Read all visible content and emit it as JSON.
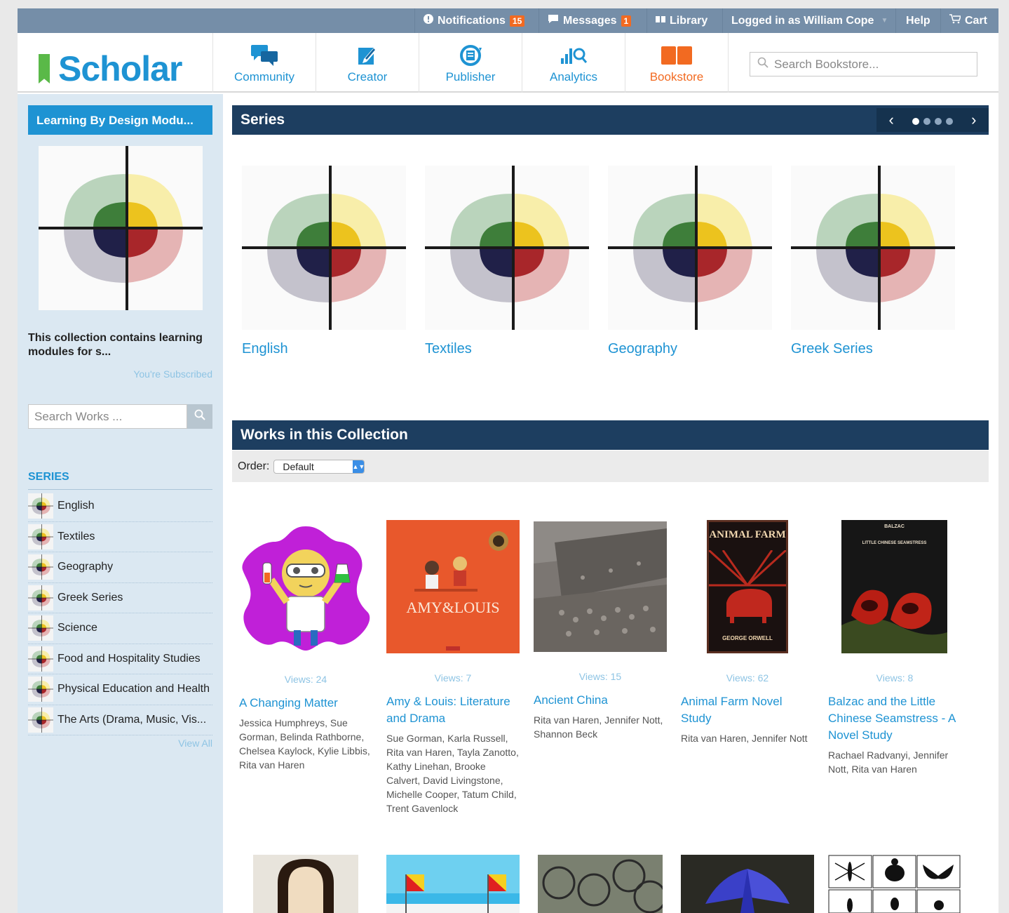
{
  "topbar": {
    "notifications_label": "Notifications",
    "notifications_count": "15",
    "messages_label": "Messages",
    "messages_count": "1",
    "library_label": "Library",
    "logged_in": "Logged in as William Cope",
    "help": "Help",
    "cart": "Cart"
  },
  "brand": {
    "name": "Scholar",
    "accent": "#1e93d3",
    "active_color": "#f26a21"
  },
  "nav": [
    {
      "label": "Community",
      "icon": "community-icon"
    },
    {
      "label": "Creator",
      "icon": "creator-icon"
    },
    {
      "label": "Publisher",
      "icon": "publisher-icon"
    },
    {
      "label": "Analytics",
      "icon": "analytics-icon"
    },
    {
      "label": "Bookstore",
      "icon": "bookstore-icon"
    }
  ],
  "search": {
    "placeholder": "Search Bookstore..."
  },
  "sidebar": {
    "collection_title": "Learning By Design Modu...",
    "description": "This collection contains learning modules for s...",
    "subscribed": "You're Subscribed",
    "search_placeholder": "Search Works ...",
    "series_heading": "SERIES",
    "series": [
      "English",
      "Textiles",
      "Geography",
      "Greek Series",
      "Science",
      "Food and Hospitality Studies",
      "Physical Education and Health",
      "The Arts (Drama, Music, Vis..."
    ],
    "view_all": "View All"
  },
  "series_section": {
    "heading": "Series",
    "items": [
      "English",
      "Textiles",
      "Geography",
      "Greek Series"
    ]
  },
  "works_section": {
    "heading": "Works in this Collection",
    "order_label": "Order:",
    "order_value": "Default",
    "works": [
      {
        "views": "Views: 24",
        "title": "A Changing Matter",
        "authors": "Jessica Humphreys, Sue Gorman, Belinda Rathborne, Chelsea Kaylock, Kylie Libbis, Rita van Haren"
      },
      {
        "views": "Views: 7",
        "title": "Amy & Louis: Literature and Drama",
        "authors": "Sue Gorman, Karla Russell, Rita van Haren, Tayla Zanotto, Kathy Linehan, Brooke Calvert, David Livingstone, Michelle Cooper, Tatum Child, Trent Gavenlock",
        "cover_title": "AMY&LOUIS"
      },
      {
        "views": "Views: 15",
        "title": "Ancient China",
        "authors": "Rita van Haren, Jennifer Nott, Shannon Beck"
      },
      {
        "views": "Views: 62",
        "title": "Animal Farm Novel Study",
        "authors": "Rita van Haren, Jennifer Nott",
        "cover_title": "ANIMAL FARM",
        "cover_author": "GEORGE ORWELL"
      },
      {
        "views": "Views: 8",
        "title": "Balzac and the Little Chinese Seamstress - A Novel Study",
        "authors": "Rachael Radvanyi, Jennifer Nott, Rita van Haren",
        "cover_title": "BALZAC",
        "cover_sub": "LITTLE CHINESE SEAMSTRESS"
      }
    ]
  }
}
